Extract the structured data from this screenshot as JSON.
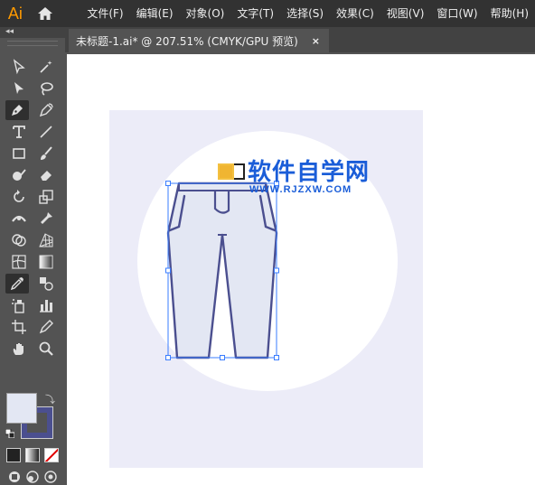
{
  "app": {
    "logo": "Ai",
    "home_icon": "home-icon"
  },
  "menu": [
    {
      "label": "文件(F)"
    },
    {
      "label": "编辑(E)"
    },
    {
      "label": "对象(O)"
    },
    {
      "label": "文字(T)"
    },
    {
      "label": "选择(S)"
    },
    {
      "label": "效果(C)"
    },
    {
      "label": "视图(V)"
    },
    {
      "label": "窗口(W)"
    },
    {
      "label": "帮助(H)"
    }
  ],
  "toolpanel": {
    "collapse_label": "◂◂",
    "tools": [
      "selection-tool-icon",
      "magic-wand-icon",
      "direct-selection-icon",
      "lasso-icon",
      "pen-tool-icon",
      "curvature-tool-icon",
      "type-tool-icon",
      "line-segment-icon",
      "rectangle-tool-icon",
      "paintbrush-icon",
      "shaper-tool-icon",
      "eraser-icon",
      "rotate-tool-icon",
      "scale-tool-icon",
      "width-tool-icon",
      "puppet-warp-icon",
      "shape-builder-icon",
      "perspective-grid-icon",
      "mesh-tool-icon",
      "gradient-tool-icon",
      "eyedropper-icon",
      "blend-tool-icon",
      "symbol-sprayer-icon",
      "column-graph-icon",
      "artboard-tool-icon",
      "slice-tool-icon",
      "hand-tool-icon",
      "zoom-tool-icon"
    ],
    "active_tools": [
      "pen-tool-icon",
      "eyedropper-icon"
    ],
    "fill_color": "#e3e7f3",
    "stroke_color": "#4b4f8f"
  },
  "document": {
    "tab_title": "未标题-1.ai* @ 207.51% (CMYK/GPU 预览)",
    "close_label": "×"
  },
  "artwork": {
    "artboard_color": "#ececf8",
    "circle_color": "#ffffff",
    "pants_fill": "#e3e7f3",
    "pants_stroke": "#4b4f8f",
    "selection_color": "#3a7dff"
  },
  "watermark": {
    "title": "软件自学网",
    "url": "WWW.RJZXW.COM"
  }
}
